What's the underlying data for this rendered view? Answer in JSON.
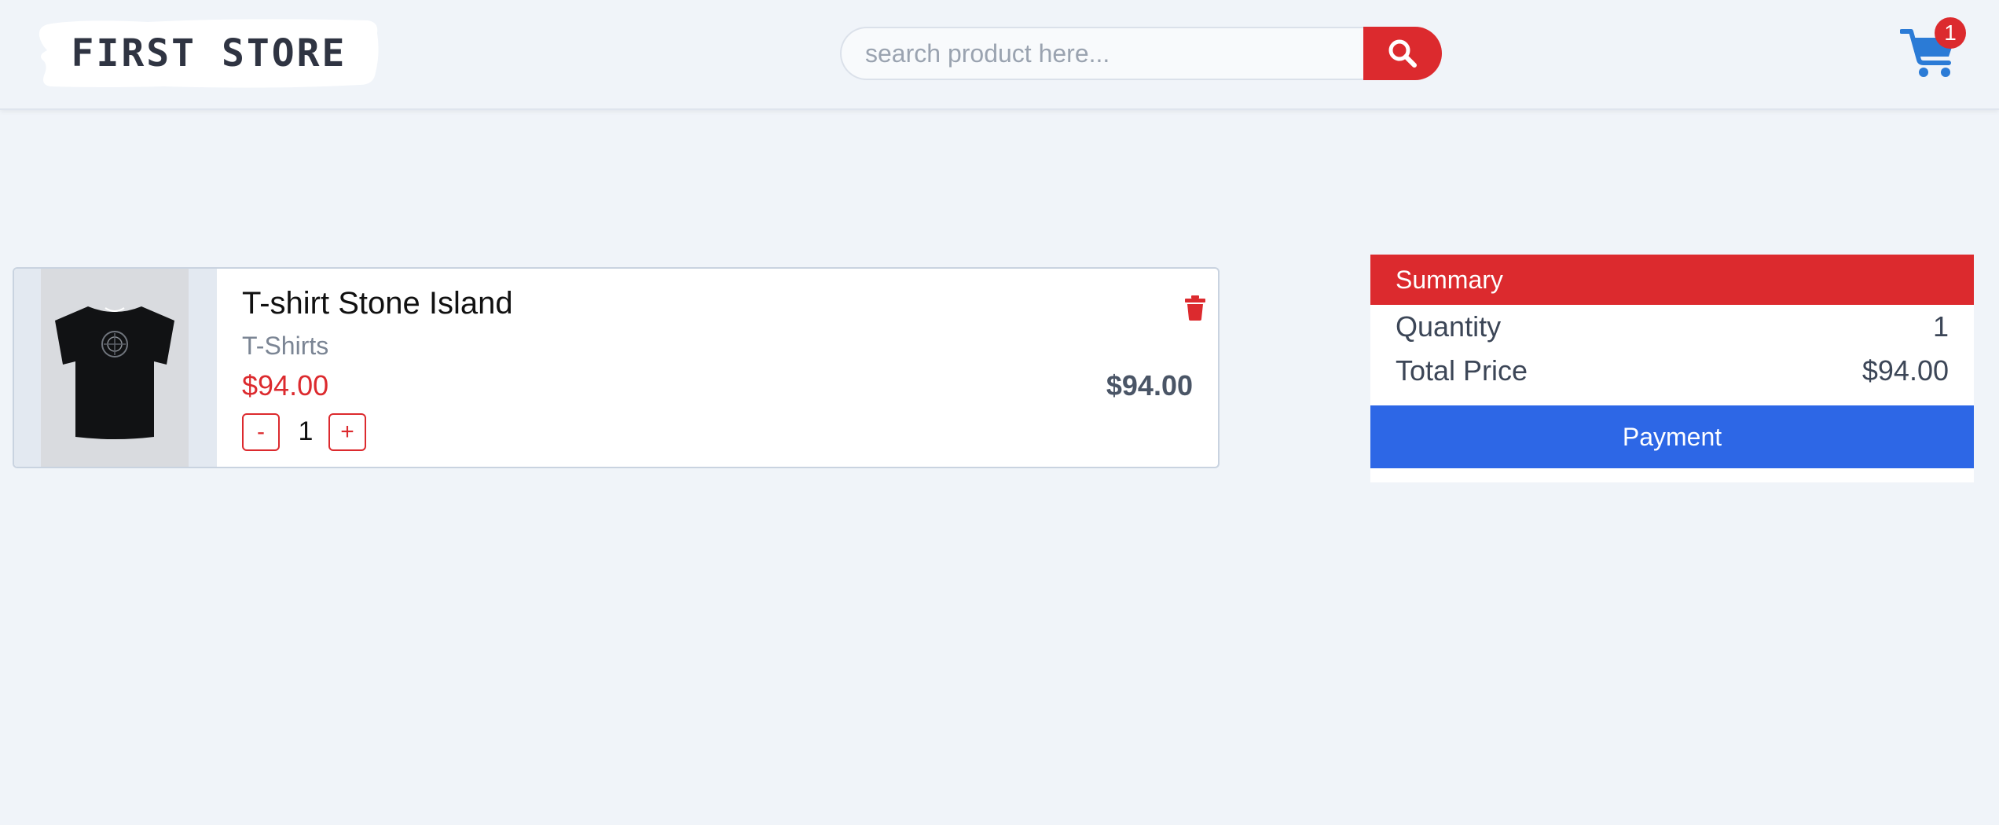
{
  "header": {
    "logo_text": "FIRST STORE",
    "search": {
      "placeholder": "search product here...",
      "value": ""
    },
    "cart_count": "1"
  },
  "cart": {
    "items": [
      {
        "name": "T-shirt Stone Island",
        "category": "T-Shirts",
        "price": "$94.00",
        "quantity": "1",
        "total": "$94.00",
        "minus_label": "-",
        "plus_label": "+"
      }
    ]
  },
  "summary": {
    "title": "Summary",
    "quantity_label": "Quantity",
    "quantity_value": "1",
    "total_label": "Total Price",
    "total_value": "$94.00",
    "payment_label": "Payment"
  },
  "colors": {
    "accent_red": "#dc2a2e",
    "primary_blue": "#2d67e6",
    "cart_icon_blue": "#2b7bd6",
    "background": "#f0f4f9"
  },
  "icons": {
    "search": "search-icon",
    "cart": "cart-icon",
    "delete": "trash-icon"
  }
}
